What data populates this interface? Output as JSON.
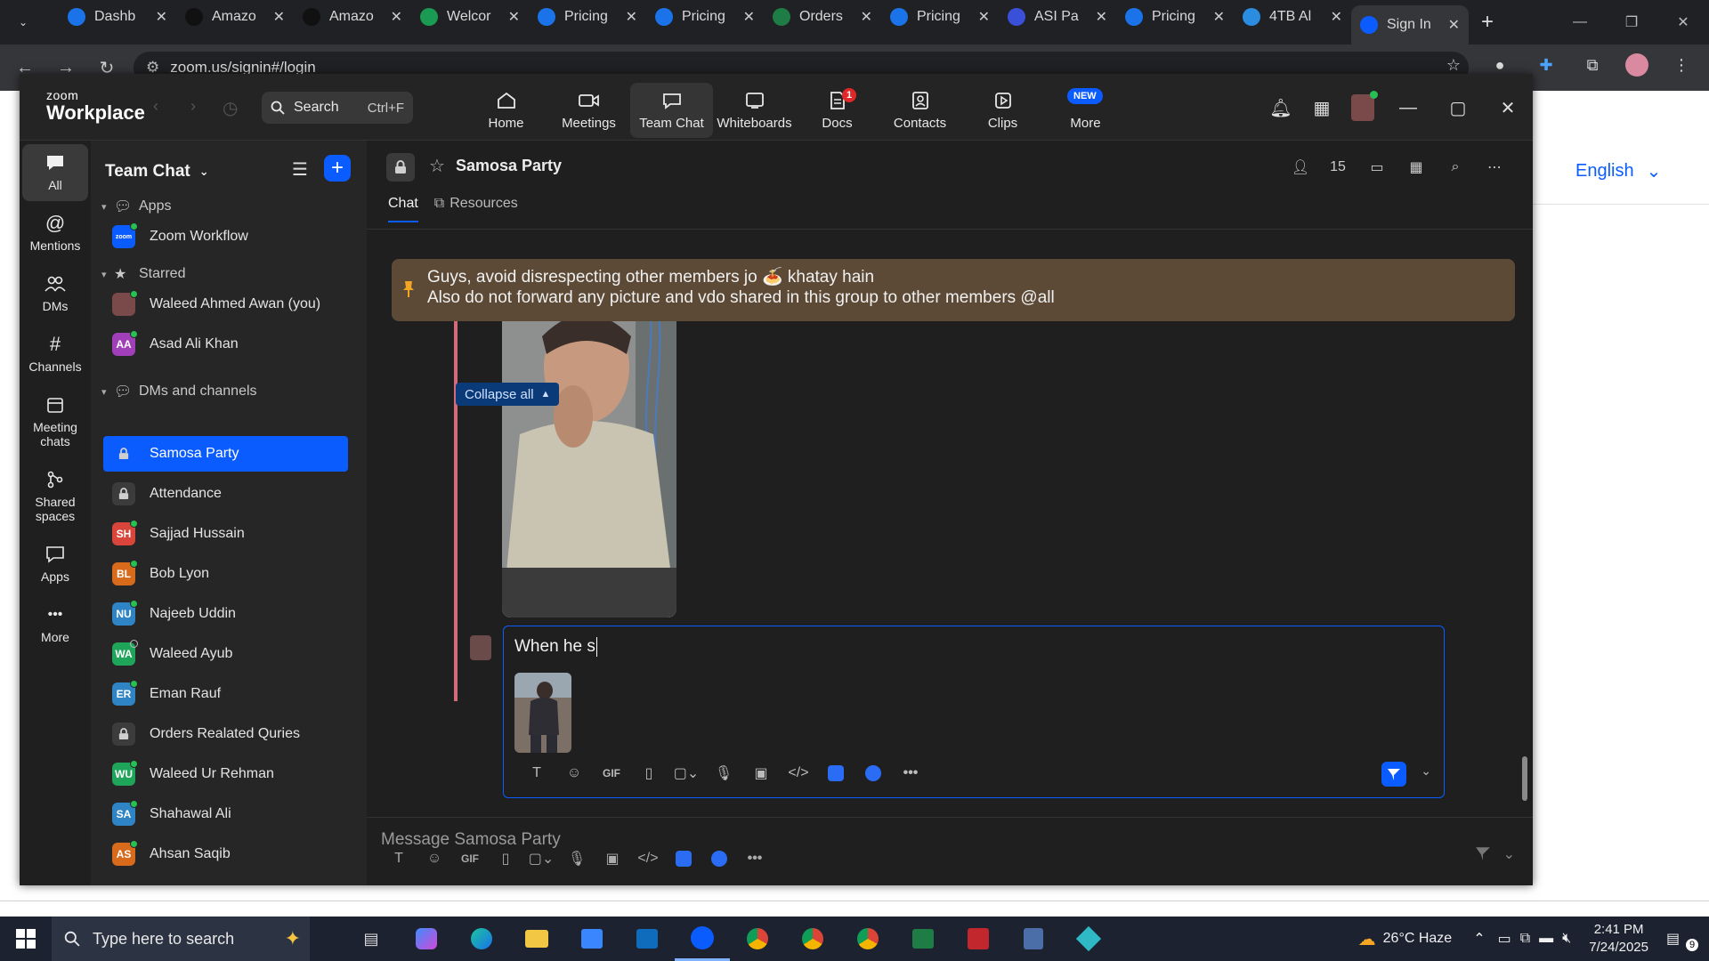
{
  "browser": {
    "tabs": [
      {
        "title": "Dashb",
        "color": "#1a73e8",
        "icon": "globe-icon"
      },
      {
        "title": "Amazo",
        "color": "#111111",
        "icon": "amazon-icon"
      },
      {
        "title": "Amazo",
        "color": "#111111",
        "icon": "amazon-icon"
      },
      {
        "title": "Welcor",
        "color": "#1a9a52",
        "icon": "ec-icon"
      },
      {
        "title": "Pricing",
        "color": "#1a73e8",
        "icon": "dollar-icon"
      },
      {
        "title": "Pricing",
        "color": "#1a73e8",
        "icon": "dollar-icon"
      },
      {
        "title": "Orders",
        "color": "#1e7d45",
        "icon": "excel-icon"
      },
      {
        "title": "Pricing",
        "color": "#1a73e8",
        "icon": "dollar-icon"
      },
      {
        "title": "ASI Pa",
        "color": "#3a50d9",
        "icon": "asi-icon"
      },
      {
        "title": "Pricing",
        "color": "#1a73e8",
        "icon": "dollar-icon"
      },
      {
        "title": "4TB Al",
        "color": "#2b8de0",
        "icon": "g-icon"
      },
      {
        "title": "Sign In",
        "color": "#0b5cff",
        "icon": "zoom-icon"
      }
    ],
    "url": "zoom.us/signin#/login"
  },
  "page": {
    "language": "English"
  },
  "zoom": {
    "logo_small": "zoom",
    "logo_big": "Workplace",
    "search_label": "Search",
    "search_shortcut": "Ctrl+F",
    "nav": [
      {
        "label": "Home",
        "icon": "home-icon"
      },
      {
        "label": "Meetings",
        "icon": "camera-icon"
      },
      {
        "label": "Team Chat",
        "icon": "chat-icon"
      },
      {
        "label": "Whiteboards",
        "icon": "whiteboard-icon"
      },
      {
        "label": "Docs",
        "icon": "docs-icon",
        "badge": "1"
      },
      {
        "label": "Contacts",
        "icon": "contacts-icon"
      },
      {
        "label": "Clips",
        "icon": "clips-icon"
      },
      {
        "label": "More",
        "icon": "more-icon",
        "badge_new": "NEW"
      }
    ],
    "rail": [
      {
        "label": "All",
        "icon": "chat-icon"
      },
      {
        "label": "Mentions",
        "icon": "at-icon"
      },
      {
        "label": "DMs",
        "icon": "people-icon"
      },
      {
        "label": "Channels",
        "icon": "hash-icon"
      },
      {
        "label": "Meeting chats",
        "icon": "calendar-icon"
      },
      {
        "label": "Shared spaces",
        "icon": "share-icon"
      },
      {
        "label": "Apps",
        "icon": "apps-chat-icon"
      },
      {
        "label": "More",
        "icon": "ellipsis-icon"
      }
    ],
    "sidebar": {
      "title": "Team Chat",
      "sections": {
        "apps": "Apps",
        "starred": "Starred",
        "dms": "DMs and channels"
      },
      "apps": [
        {
          "name": "Zoom Workflow"
        }
      ],
      "starred": [
        {
          "name": "Waleed Ahmed Awan (you)",
          "initials": "",
          "color": "#7a4a4a"
        },
        {
          "name": "Asad Ali Khan",
          "initials": "AA",
          "color": "#a13fb8"
        }
      ],
      "dms": [
        {
          "name": "Samosa Party",
          "type": "lock",
          "active": true
        },
        {
          "name": "Attendance",
          "type": "lock"
        },
        {
          "name": "Sajjad Hussain",
          "initials": "SH",
          "color": "#d9453a"
        },
        {
          "name": "Bob Lyon",
          "initials": "BL",
          "color": "#d86a1c"
        },
        {
          "name": "Najeeb Uddin",
          "initials": "NU",
          "color": "#2f84c5"
        },
        {
          "name": "Waleed Ayub",
          "initials": "WA",
          "color": "#1fa55a",
          "away": true
        },
        {
          "name": "Eman Rauf",
          "initials": "ER",
          "color": "#2f84c5"
        },
        {
          "name": "Orders Realated Quries",
          "type": "lock"
        },
        {
          "name": "Waleed Ur Rehman",
          "initials": "WU",
          "color": "#1fa55a"
        },
        {
          "name": "Shahawal Ali",
          "initials": "SA",
          "color": "#2f84c5"
        },
        {
          "name": "Ahsan Saqib",
          "initials": "AS",
          "color": "#d86a1c"
        }
      ]
    },
    "channel": {
      "name": "Samosa Party",
      "members": "15",
      "tabs": [
        "Chat",
        "Resources"
      ],
      "pinned_line1": "Guys, avoid disrespecting other members jo 🍝 khatay hain",
      "pinned_line2": "Also do not forward any picture and vdo shared in this group to other members @all",
      "collapse_label": "Collapse all",
      "composer_text": "When he s",
      "message_placeholder": "Message Samosa Party"
    }
  },
  "taskbar": {
    "search_placeholder": "Type here to search",
    "weather": "26°C Haze",
    "time": "2:41 PM",
    "date": "7/24/2025",
    "notification_count": "9"
  },
  "colors": {
    "accent": "#0b5cff",
    "pinned_bg": "#5c4a36",
    "thread_line": "#d56b7a"
  }
}
